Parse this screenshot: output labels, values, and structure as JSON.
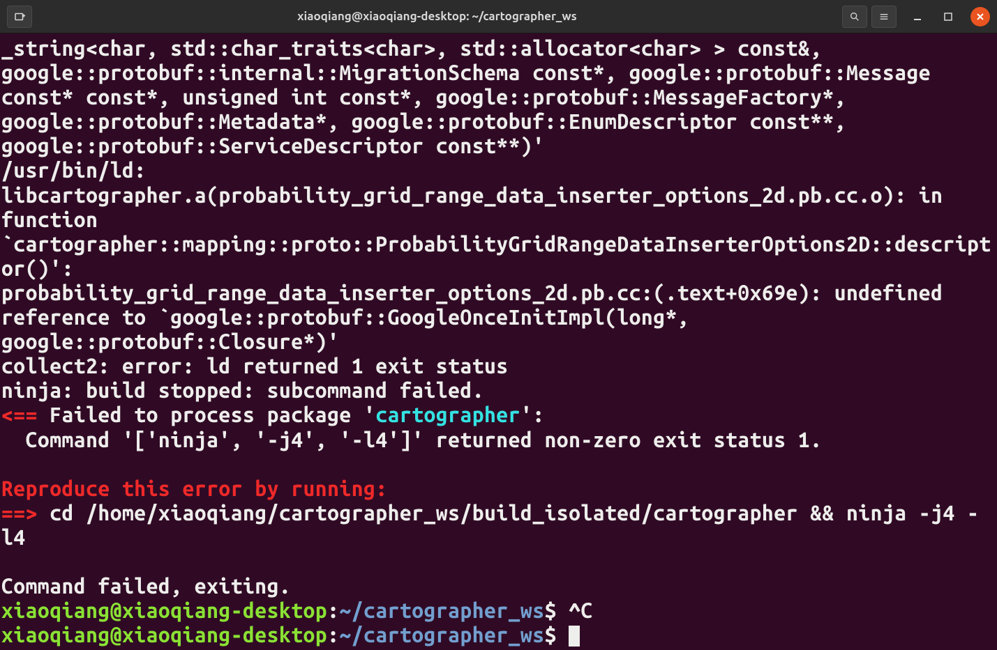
{
  "titlebar": {
    "title": "xiaoqiang@xiaoqiang-desktop: ~/cartographer_ws"
  },
  "terminal": {
    "line1": "_string<char, std::char_traits<char>, std::allocator<char> > const&, google::protobuf::internal::MigrationSchema const*, google::protobuf::Message const* const*, unsigned int const*, google::protobuf::MessageFactory*, google::protobuf::Metadata*, google::protobuf::EnumDescriptor const**, google::protobuf::ServiceDescriptor const**)'",
    "line2": "/usr/bin/ld: libcartographer.a(probability_grid_range_data_inserter_options_2d.pb.cc.o): in function `cartographer::mapping::proto::ProbabilityGridRangeDataInserterOptions2D::descriptor()':",
    "line3": "probability_grid_range_data_inserter_options_2d.pb.cc:(.text+0x69e): undefined reference to `google::protobuf::GoogleOnceInitImpl(long*, google::protobuf::Closure*)'",
    "line4": "collect2: error: ld returned 1 exit status",
    "line5": "ninja: build stopped: subcommand failed.",
    "fail_arrow": "<==",
    "fail_text_1": " Failed to process package '",
    "fail_pkg": "cartographer",
    "fail_text_2": "': ",
    "line7": "  Command '['ninja', '-j4', '-l4']' returned non-zero exit status 1.",
    "reproduce_header": "Reproduce this error by running:",
    "repro_arrow": "==>",
    "repro_cmd": " cd /home/xiaoqiang/cartographer_ws/build_isolated/cartographer && ninja -j4 -l4",
    "cmd_failed": "Command failed, exiting.",
    "prompt_user": "xiaoqiang@xiaoqiang-desktop",
    "prompt_colon": ":",
    "prompt_path": "~/cartographer_ws",
    "prompt_dollar": "$ ",
    "ctrl_c": "^C"
  }
}
